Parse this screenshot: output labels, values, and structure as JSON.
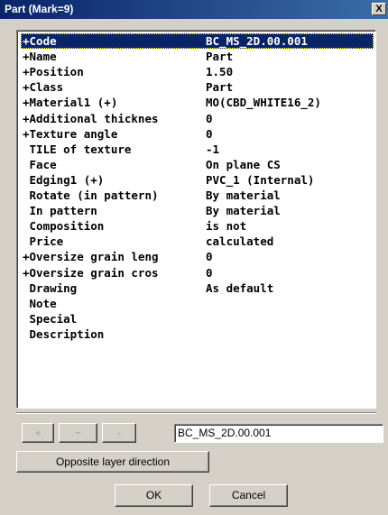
{
  "window": {
    "title": "Part (Mark=9)",
    "close_label": "X"
  },
  "properties": [
    {
      "name": "+Code",
      "value": "BC_MS_2D.00.001",
      "selected": true
    },
    {
      "name": "+Name",
      "value": "Part"
    },
    {
      "name": "+Position",
      "value": "1.50"
    },
    {
      "name": "+Class",
      "value": "Part"
    },
    {
      "name": "+Material1 (+)",
      "value": "MO(CBD_WHITE16_2)"
    },
    {
      "name": "+Additional thicknes",
      "value": "0"
    },
    {
      "name": "+Texture angle",
      "value": "0"
    },
    {
      "name": " TILE of texture",
      "value": "-1"
    },
    {
      "name": " Face",
      "value": "On plane CS"
    },
    {
      "name": " Edging1 (+)",
      "value": "PVC_1 (Internal)"
    },
    {
      "name": " Rotate (in pattern)",
      "value": "By material"
    },
    {
      "name": " In pattern",
      "value": "By material"
    },
    {
      "name": " Composition",
      "value": "is not"
    },
    {
      "name": " Price",
      "value": "calculated"
    },
    {
      "name": "+Oversize grain leng",
      "value": "0"
    },
    {
      "name": "+Oversize grain cros",
      "value": "0"
    },
    {
      "name": " Drawing",
      "value": "As default"
    },
    {
      "name": " Note",
      "value": ""
    },
    {
      "name": " Special",
      "value": ""
    },
    {
      "name": " Description",
      "value": ""
    }
  ],
  "toolbar": {
    "plus_label": "+",
    "tilde_label": "~",
    "minus_label": "-"
  },
  "edit": {
    "value": "BC_MS_2D.00.001"
  },
  "buttons": {
    "opposite_label": "Opposite layer direction",
    "ok_label": "OK",
    "cancel_label": "Cancel"
  }
}
